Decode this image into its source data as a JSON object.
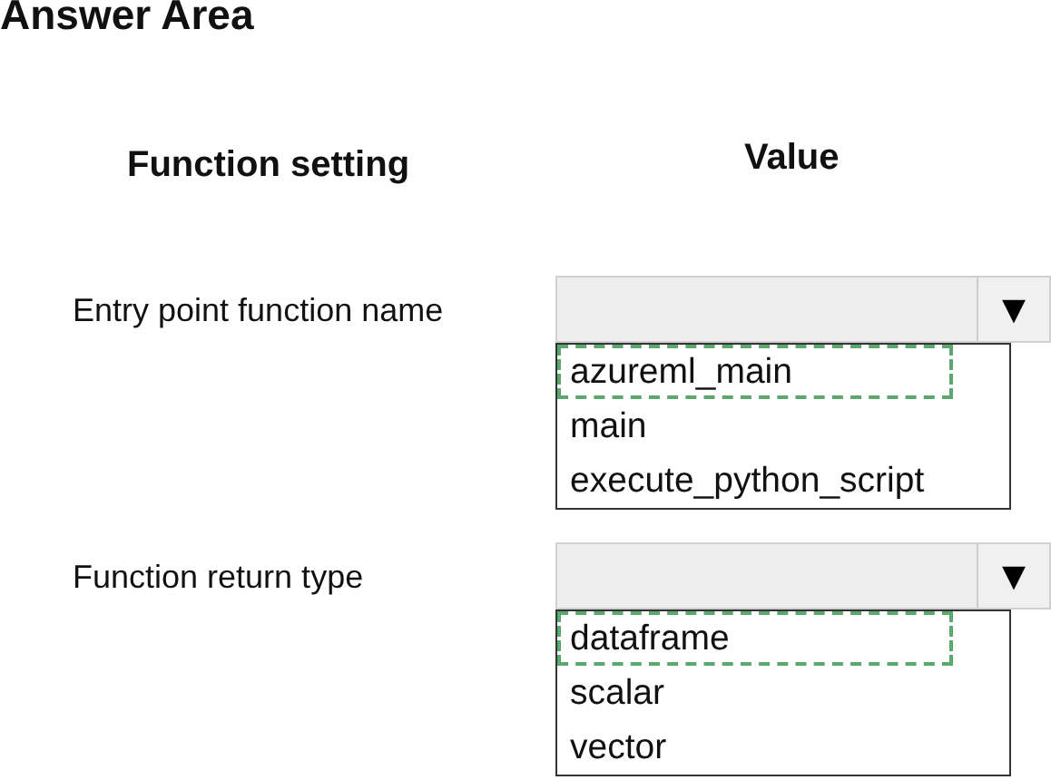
{
  "title": "Answer Area",
  "columns": [
    "Function setting",
    "Value"
  ],
  "settings": [
    {
      "label": "Entry point function name",
      "dropdown_arrow": "▼",
      "options": [
        {
          "text": "azureml_main",
          "selected": true
        },
        {
          "text": "main",
          "selected": false
        },
        {
          "text": "execute_python_script",
          "selected": false
        }
      ]
    },
    {
      "label": "Function return type",
      "dropdown_arrow": "▼",
      "options": [
        {
          "text": "dataframe",
          "selected": true
        },
        {
          "text": "scalar",
          "selected": false
        },
        {
          "text": "vector",
          "selected": false
        }
      ]
    }
  ]
}
